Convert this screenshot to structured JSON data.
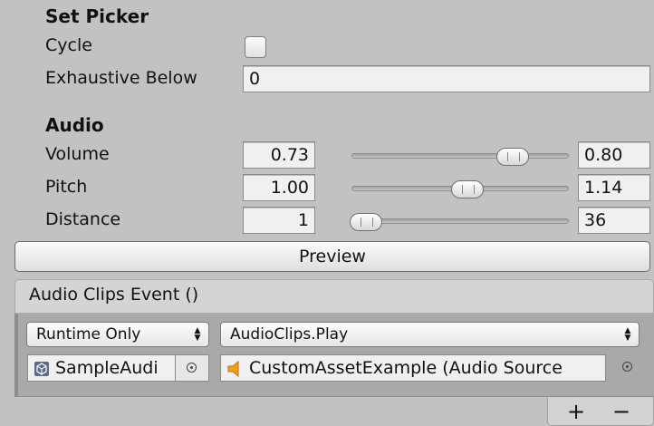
{
  "set_picker": {
    "header": "Set Picker",
    "cycle_label": "Cycle",
    "cycle_checked": false,
    "exhaustive_label": "Exhaustive Below",
    "exhaustive_value": "0"
  },
  "audio": {
    "header": "Audio",
    "rows": [
      {
        "label": "Volume",
        "min": "0.73",
        "max": "0.80",
        "range_min_fraction": 0.65,
        "range_max_fraction": 0.8
      },
      {
        "label": "Pitch",
        "min": "1.00",
        "max": "1.14",
        "range_min_fraction": 0.45,
        "range_max_fraction": 0.55
      },
      {
        "label": "Distance",
        "min": "1",
        "max": "36",
        "range_min_fraction": 0.0,
        "range_max_fraction": 0.05
      }
    ]
  },
  "preview_button": "Preview",
  "event": {
    "title": "Audio Clips Event ()",
    "runtime_option": "Runtime Only",
    "function": "AudioClips.Play",
    "object_field": "SampleAudio",
    "object_field_visible": "SampleAudi",
    "argument_field": "CustomAssetExample (Audio Source)",
    "argument_field_visible": "CustomAssetExample (Audio Source",
    "add_label": "+",
    "remove_label": "−"
  },
  "colors": {
    "background": "#c2c2c2",
    "field_bg": "#f0f0f0",
    "audio_icon": "#f0a020"
  },
  "icons": {
    "object_icon": "unity-cube-icon",
    "audio_icon": "speaker-icon",
    "picker_icon": "object-picker-icon"
  }
}
